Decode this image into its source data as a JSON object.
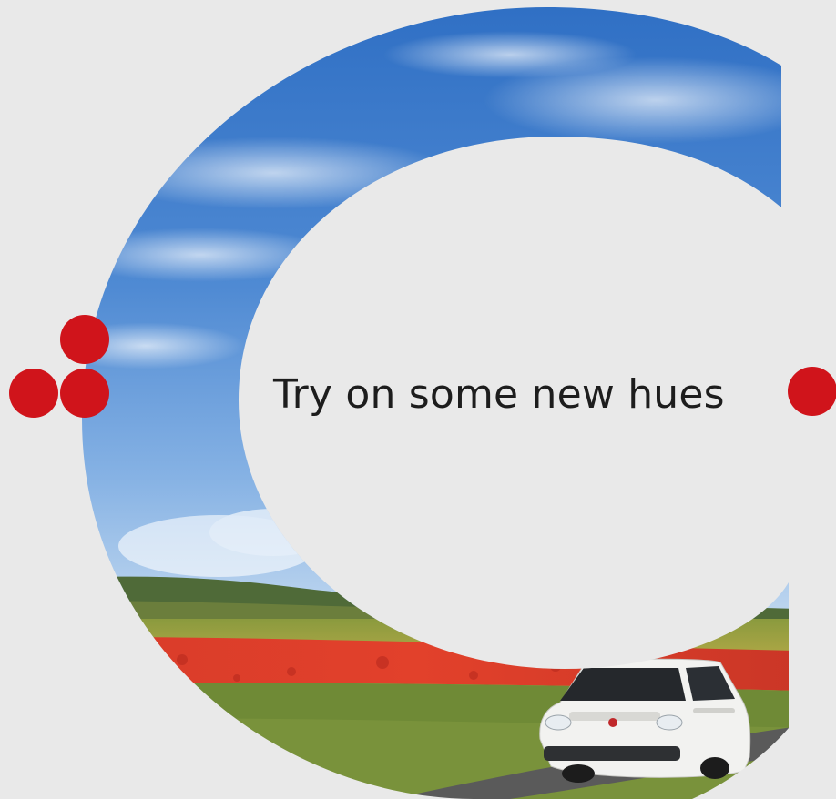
{
  "headline": "Try on some new hues",
  "colors": {
    "background": "#e9e9e9",
    "dot": "#d0141b",
    "sky": "#4f86cf",
    "poppy": "#d83227",
    "grass": "#6f8a36",
    "car_body": "#f2f2f0"
  },
  "decor": {
    "dot_count_left": 3,
    "dot_count_right": 1,
    "shape": "letter-c-photo-mask",
    "photo_subject": "car-on-road-through-poppy-field"
  }
}
